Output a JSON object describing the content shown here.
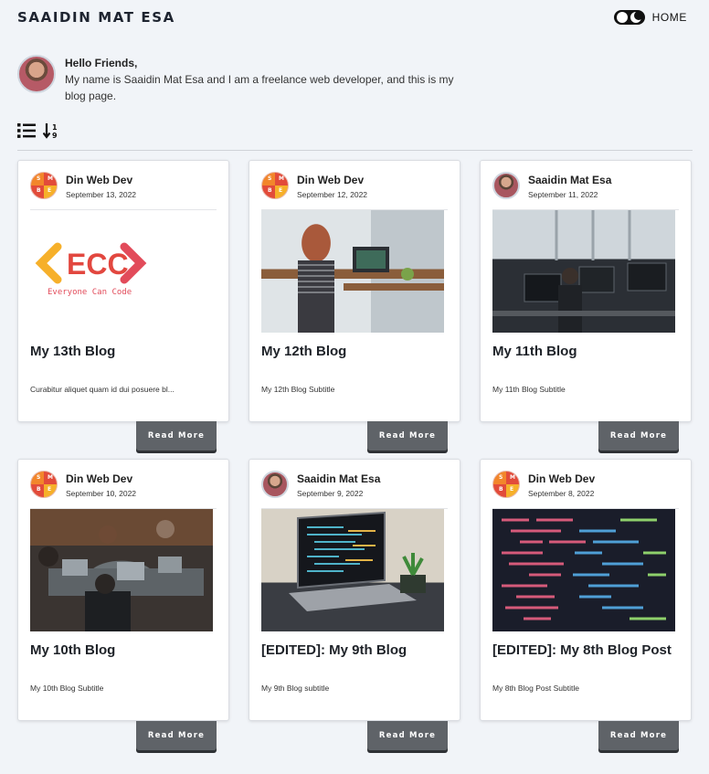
{
  "site": {
    "title": "SAAIDIN MAT ESA",
    "home_label": "HOME",
    "theme_toggle_icon": "theme-toggle-icon"
  },
  "intro": {
    "greeting": "Hello Friends,",
    "message": "My name is Saaidin Mat Esa and I am a freelance web developer, and this is my blog page."
  },
  "toolbar": {
    "list_icon": "list-view-icon",
    "sort_icon": "sort-numeric-icon"
  },
  "ecc_logo": {
    "letters": "ECC",
    "tagline": "Everyone Can Code"
  },
  "avatar_logo_letters": [
    "S",
    "M",
    "B",
    "E"
  ],
  "read_more_label": "Read More",
  "posts": [
    {
      "author": "Din Web Dev",
      "date": "September 13, 2022",
      "title": "My 13th Blog",
      "subtitle": "Curabitur aliquet quam id dui posuere bl...",
      "image": "ecc-logo-image",
      "avatar": "logo"
    },
    {
      "author": "Din Web Dev",
      "date": "September 12, 2022",
      "title": "My 12th Blog",
      "subtitle": "My 12th Blog Subtitle",
      "image": "woman-laptop-cafe-photo",
      "avatar": "logo"
    },
    {
      "author": "Saaidin Mat Esa",
      "date": "September 11, 2022",
      "title": "My 11th Blog",
      "subtitle": "My 11th Blog Subtitle",
      "image": "office-computers-photo",
      "avatar": "photo"
    },
    {
      "author": "Din Web Dev",
      "date": "September 10, 2022",
      "title": "My 10th Blog",
      "subtitle": "My 10th Blog Subtitle",
      "image": "team-meeting-photo",
      "avatar": "logo"
    },
    {
      "author": "Saaidin Mat Esa",
      "date": "September 9, 2022",
      "title": "[EDITED]: My 9th Blog",
      "subtitle": "My 9th Blog subtitle",
      "image": "laptop-code-plant-photo",
      "avatar": "photo"
    },
    {
      "author": "Din Web Dev",
      "date": "September 8, 2022",
      "title": "[EDITED]: My 8th Blog Post",
      "subtitle": "My 8th Blog Post Subtitle",
      "image": "code-screen-photo",
      "avatar": "logo"
    }
  ]
}
